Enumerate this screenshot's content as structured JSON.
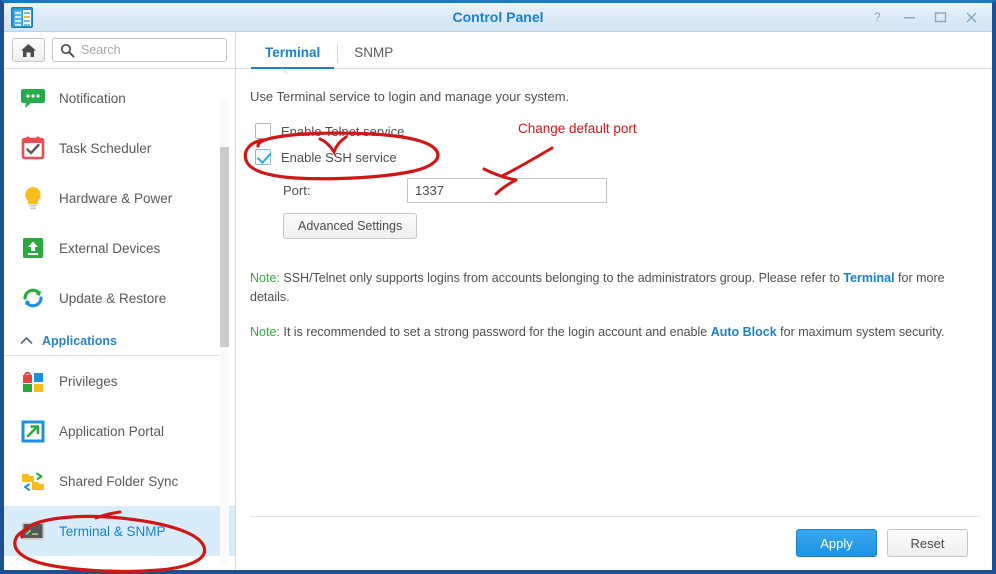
{
  "window": {
    "title": "Control Panel",
    "app_icon": "control-panel-icon",
    "controls": [
      {
        "name": "help-button",
        "glyph": "?"
      },
      {
        "name": "minimize-button",
        "glyph": "—"
      },
      {
        "name": "maximize-button",
        "glyph": "□"
      },
      {
        "name": "close-button",
        "glyph": "✕"
      }
    ]
  },
  "sidebar": {
    "home_icon": "home-icon",
    "search": {
      "value": "",
      "placeholder": "Search",
      "icon": "search-icon"
    },
    "items": [
      {
        "label": "Notification",
        "icon": "speech-bubble-icon",
        "selected": false
      },
      {
        "label": "Task Scheduler",
        "icon": "calendar-check-icon",
        "selected": false
      },
      {
        "label": "Hardware & Power",
        "icon": "lightbulb-icon",
        "selected": false
      },
      {
        "label": "External Devices",
        "icon": "green-upload-box-icon",
        "selected": false
      },
      {
        "label": "Update & Restore",
        "icon": "refresh-arrows-icon",
        "selected": false
      }
    ],
    "group": {
      "label": "Applications",
      "icon": "chevron-up-icon",
      "expanded": true
    },
    "app_items": [
      {
        "label": "Privileges",
        "icon": "privileges-squares-icon",
        "selected": false
      },
      {
        "label": "Application Portal",
        "icon": "portal-arrow-icon",
        "selected": false
      },
      {
        "label": "Shared Folder Sync",
        "icon": "folder-sync-icon",
        "selected": false
      },
      {
        "label": "Terminal & SNMP",
        "icon": "terminal-icon",
        "selected": true
      }
    ]
  },
  "tabs": [
    {
      "label": "Terminal",
      "active": true
    },
    {
      "label": "SNMP",
      "active": false
    }
  ],
  "panel": {
    "intro": "Use Terminal service to login and manage your system.",
    "telnet": {
      "label": "Enable Telnet service",
      "checked": false
    },
    "ssh": {
      "label": "Enable SSH service",
      "checked": true
    },
    "port": {
      "label": "Port:",
      "value": "1337"
    },
    "advanced_button": "Advanced Settings",
    "note1": {
      "tag": "Note:",
      "text_before": " SSH/Telnet only supports logins from accounts belonging to the administrators group. Please refer to ",
      "link": "Terminal",
      "text_after": " for more details."
    },
    "note2": {
      "tag": "Note:",
      "text_before": " It is recommended to set a strong password for the login account and enable ",
      "link": "Auto Block",
      "text_after": " for maximum system security."
    }
  },
  "footer": {
    "apply_label": "Apply",
    "reset_label": "Reset"
  },
  "annotations": {
    "change_port_text": "Change default port",
    "ink_color": "#d01717"
  },
  "colors": {
    "accent_blue": "#1a81d0",
    "title_blue": "#1a81d0",
    "selected_row": "#d8ecfa",
    "note_green": "#3aa845",
    "window_frame": "#1d4f91"
  }
}
